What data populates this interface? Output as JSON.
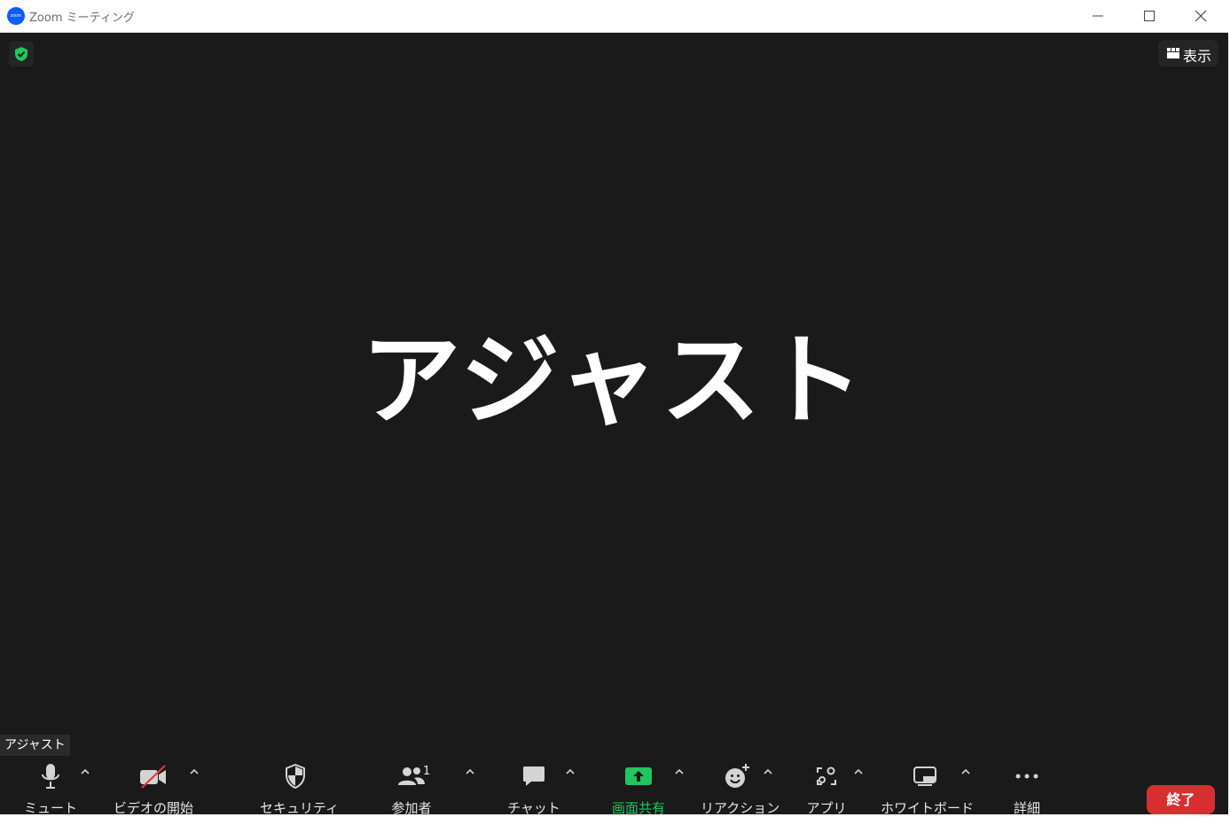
{
  "window": {
    "app_logo_text": "zoom",
    "title": "Zoom ミーティング",
    "controls": [
      "minimize-icon",
      "maximize-icon",
      "close-icon"
    ]
  },
  "meeting": {
    "participant_name_display": "アジャスト",
    "name_tag": "アジャスト",
    "view_button_label": "表示",
    "encryption_shield_color": "#22c55e"
  },
  "toolbar": {
    "mute": "ミュート",
    "start_video": "ビデオの開始",
    "security": "セキュリティ",
    "participants": "参加者",
    "participants_count": "1",
    "chat": "チャット",
    "share_screen": "画面共有",
    "reactions": "リアクション",
    "apps": "アプリ",
    "whiteboard": "ホワイトボード",
    "more": "詳細",
    "end": "終了"
  },
  "colors": {
    "background": "#1a1a1a",
    "share_green": "#22c55e",
    "end_red": "#d62f2f",
    "zoom_blue": "#0b5cff"
  }
}
